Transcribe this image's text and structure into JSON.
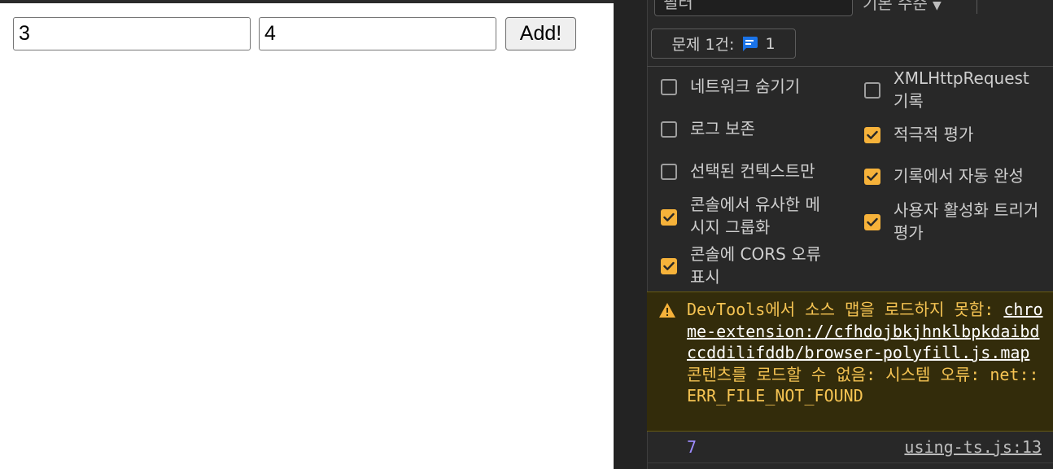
{
  "app": {
    "inputs": [
      {
        "value": "3"
      },
      {
        "value": "4"
      }
    ],
    "add_button_label": "Add!"
  },
  "devtools": {
    "filter_placeholder": "필터",
    "levels_label": "기본 수준",
    "issues": {
      "label": "문제 1건:",
      "count": "1"
    },
    "settings": [
      {
        "label": "네트워크 숨기기",
        "checked": false
      },
      {
        "label": "XMLHttpRequest 기록",
        "checked": false
      },
      {
        "label": "로그 보존",
        "checked": false
      },
      {
        "label": "적극적 평가",
        "checked": true
      },
      {
        "label": "선택된 컨텍스트만",
        "checked": false
      },
      {
        "label": "기록에서 자동 완성",
        "checked": true
      },
      {
        "label": "콘솔에서 유사한 메시지 그룹화",
        "checked": true
      },
      {
        "label": "사용자 활성화 트리거 평가",
        "checked": true
      },
      {
        "label": "콘솔에 CORS 오류 표시",
        "checked": true
      }
    ],
    "warning": {
      "prefix": "DevTools에서 소스 맵을 로드하지 못함: ",
      "link": "chrome-extension://cfhdojbkjhnklbpkdaibdccddilifddb/browser-polyfill.js.map",
      "suffix": " 콘텐츠를 로드할 수 없음: 시스템 오류: net::ERR_FILE_NOT_FOUND"
    },
    "log": {
      "value": "7",
      "source": "using-ts.js:13"
    },
    "colors": {
      "checkbox_checked": "#f6b23a",
      "warning_text": "#f6c453",
      "warning_bg": "#332c0b",
      "log_value": "#9e8cff",
      "issue_icon": "#1a73e8"
    }
  }
}
